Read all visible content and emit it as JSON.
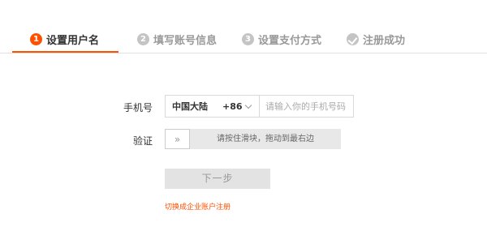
{
  "steps": [
    {
      "num": "1",
      "label": "设置用户名",
      "state": "active"
    },
    {
      "num": "2",
      "label": "填写账号信息",
      "state": "inactive"
    },
    {
      "num": "3",
      "label": "设置支付方式",
      "state": "inactive"
    },
    {
      "num": "",
      "label": "注册成功",
      "state": "inactive",
      "icon": "check-icon"
    }
  ],
  "form": {
    "phone_label": "手机号",
    "country": "中国大陆",
    "country_code": "+86",
    "phone_placeholder": "请输入你的手机号码",
    "verify_label": "验证",
    "slider_handle": "»",
    "slider_text": "请按住滑块，拖动到最右边",
    "next_button": "下一步",
    "switch_link": "切换成企业账户注册"
  },
  "colors": {
    "accent": "#ff5000",
    "inactive": "#c4c4c4"
  }
}
